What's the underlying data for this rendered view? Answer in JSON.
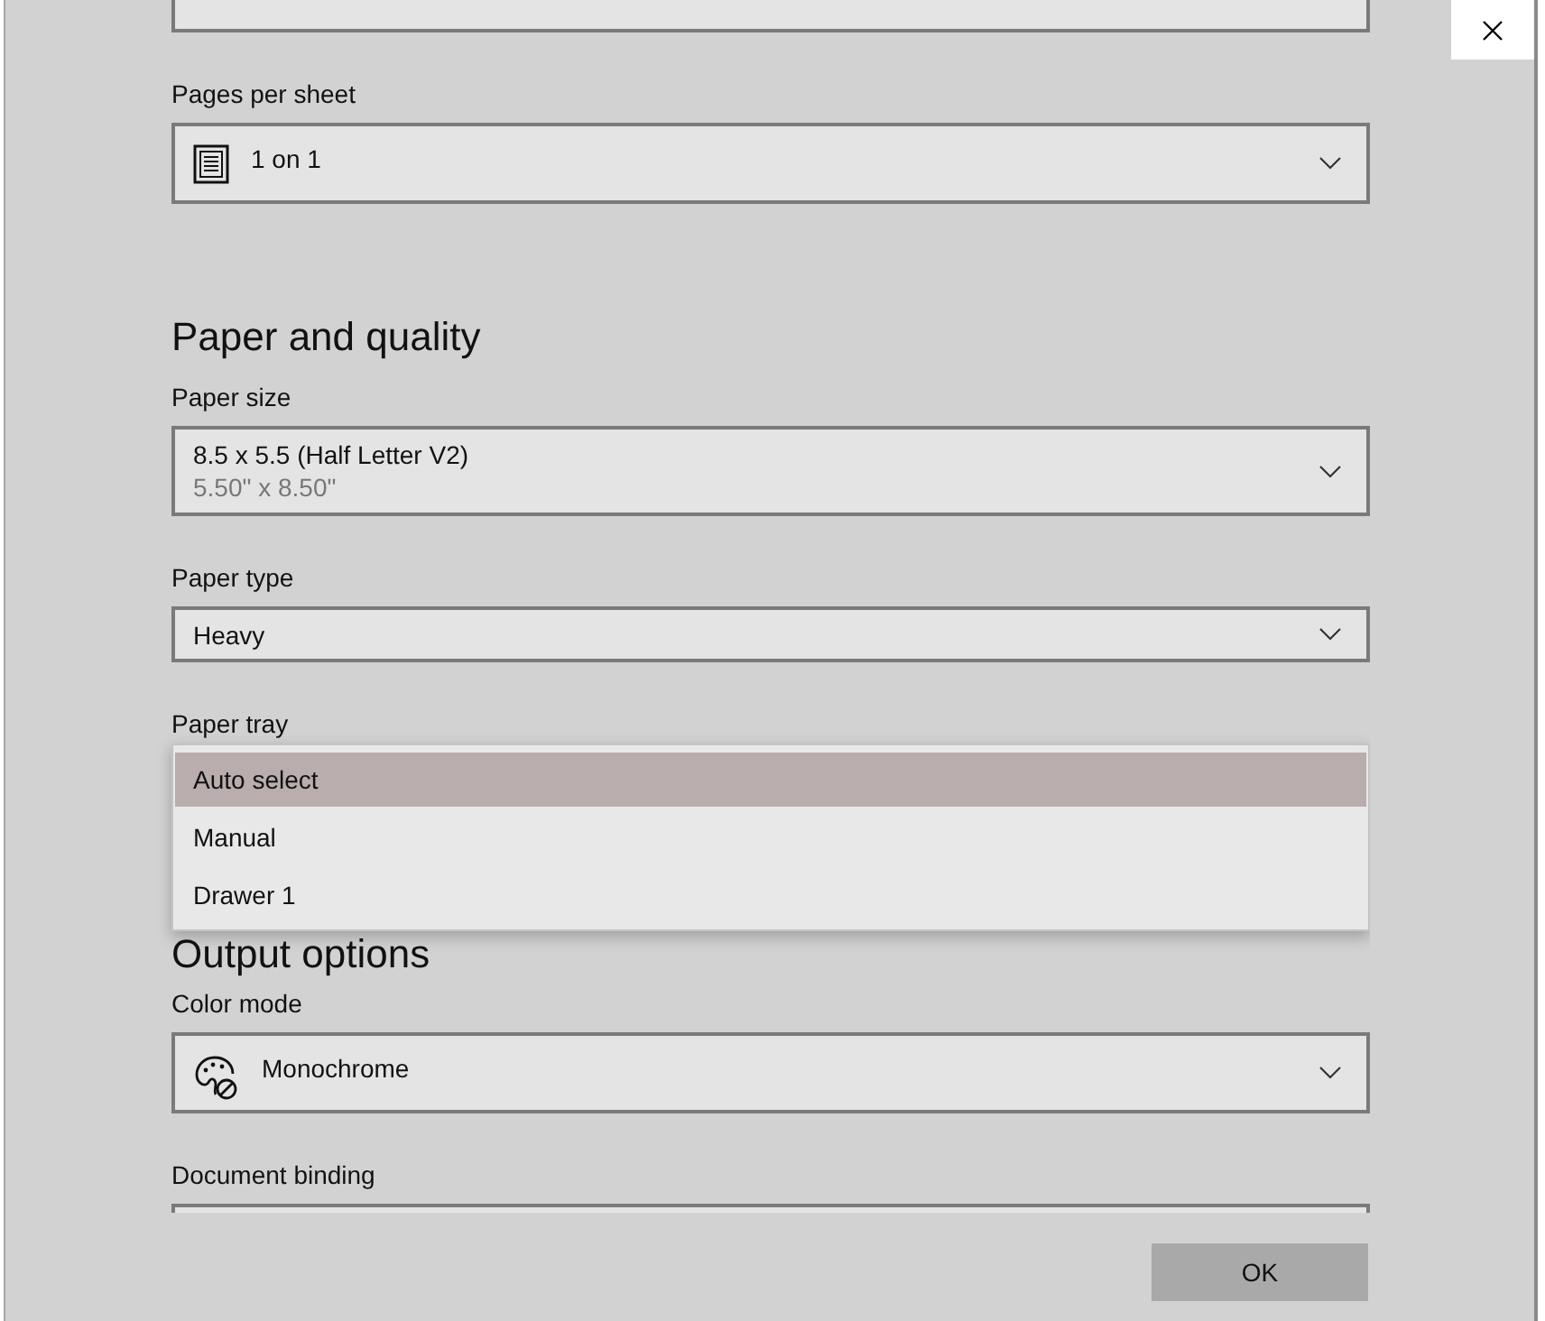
{
  "pages_per_sheet": {
    "label": "Pages per sheet",
    "value": "1 on 1"
  },
  "paper_and_quality": {
    "heading": "Paper and quality",
    "paper_size": {
      "label": "Paper size",
      "value": "8.5 x 5.5 (Half Letter V2)",
      "detail": "5.50\" x 8.50\""
    },
    "paper_type": {
      "label": "Paper type",
      "value": "Heavy"
    },
    "paper_tray": {
      "label": "Paper tray",
      "options": [
        {
          "label": "Auto select",
          "selected": true
        },
        {
          "label": "Manual",
          "selected": false
        },
        {
          "label": "Drawer 1",
          "selected": false
        }
      ]
    }
  },
  "output_options": {
    "heading": "Output options",
    "color_mode": {
      "label": "Color mode",
      "value": "Monochrome"
    },
    "document_binding": {
      "label": "Document binding"
    }
  },
  "footer": {
    "ok_button": "OK"
  }
}
